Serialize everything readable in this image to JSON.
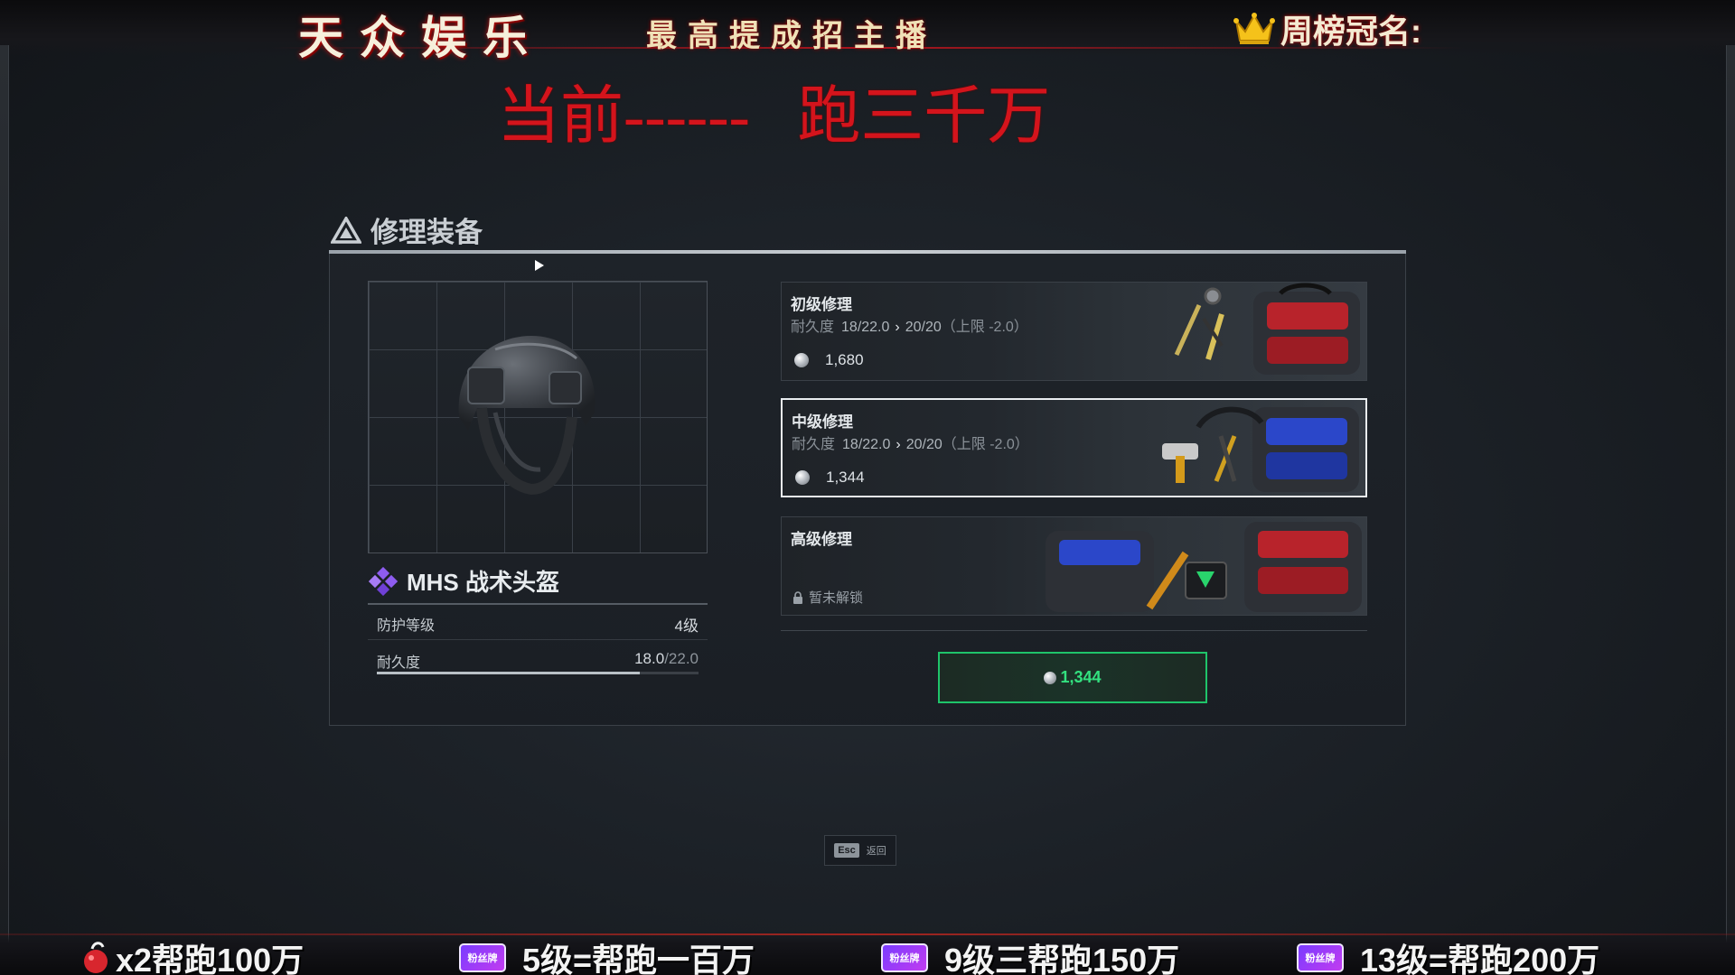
{
  "overlay": {
    "brand": "天众娱乐",
    "brand_sub": "最高提成招主播",
    "weekly_label": "周榜冠名:",
    "headline": "当前------   跑三千万",
    "ticker": [
      {
        "text": "x2帮跑100万",
        "icon": "gift-icon"
      },
      {
        "text": "5级=帮跑一百万",
        "icon": "fan-badge-icon",
        "badge": "粉丝牌"
      },
      {
        "text": "9级三帮跑150万",
        "icon": "fan-badge-icon",
        "badge": "粉丝牌"
      },
      {
        "text": "13级=帮跑200万",
        "icon": "fan-badge-icon",
        "badge": "粉丝牌"
      }
    ]
  },
  "panel": {
    "title": "修理装备",
    "item": {
      "name": "MHS 战术头盔",
      "protection_label": "防护等级",
      "protection_value": "4级",
      "durability_label": "耐久度",
      "durability_current": "18.0",
      "durability_max": "/22.0",
      "durability_fraction": 0.818
    },
    "options": [
      {
        "title": "初级修理",
        "dur_label": "耐久度",
        "dur_from": "18/22.0",
        "dur_to": "20/20",
        "limit": "（上限 -2.0）",
        "price": "1,680",
        "selected": false,
        "locked": false
      },
      {
        "title": "中级修理",
        "dur_label": "耐久度",
        "dur_from": "18/22.0",
        "dur_to": "20/20",
        "limit": "（上限 -2.0）",
        "price": "1,344",
        "selected": true,
        "locked": false
      },
      {
        "title": "高级修理",
        "lock_text": "暂未解锁",
        "locked": true
      }
    ],
    "confirm_price": "1,344",
    "esc_key": "Esc",
    "esc_label": "返回"
  },
  "colors": {
    "accent_green": "#1fc46a",
    "headline_red": "#d4141c",
    "rarity_purple": "#8e5cf0"
  }
}
